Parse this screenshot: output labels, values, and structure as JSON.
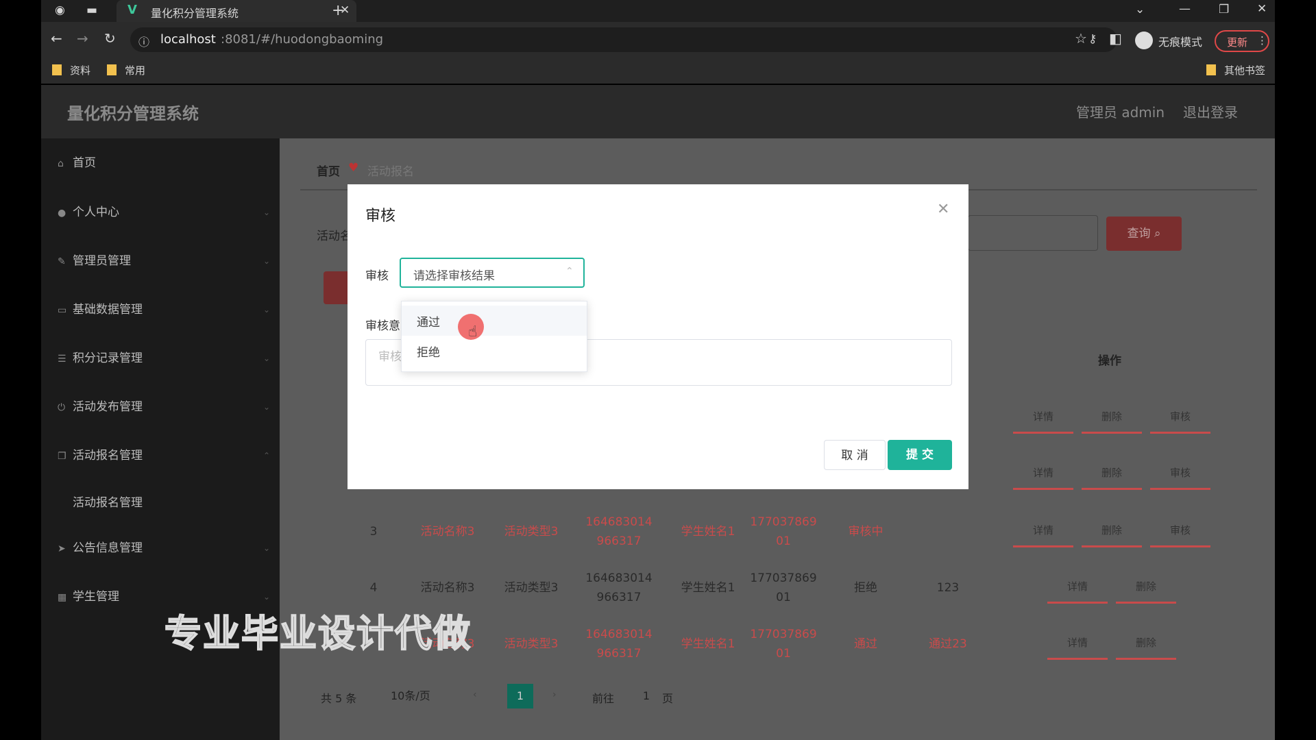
{
  "browser": {
    "tab_title": "量化积分管理系统",
    "url_host": "localhost",
    "url_rest": ":8081/#/huodongbaoming",
    "incognito_label": "无痕模式",
    "update_label": "更新",
    "bookmarks": [
      "资料",
      "常用"
    ],
    "other_bookmarks": "其他书签"
  },
  "header": {
    "app_title": "量化积分管理系统",
    "user_label": "管理员 admin",
    "logout_label": "退出登录"
  },
  "sidebar": {
    "items": [
      {
        "label": "首页"
      },
      {
        "label": "个人中心"
      },
      {
        "label": "管理员管理"
      },
      {
        "label": "基础数据管理"
      },
      {
        "label": "积分记录管理"
      },
      {
        "label": "活动发布管理"
      },
      {
        "label": "活动报名管理"
      },
      {
        "label": "活动报名管理"
      },
      {
        "label": "公告信息管理"
      },
      {
        "label": "学生管理"
      }
    ]
  },
  "breadcrumb": {
    "home": "首页",
    "current": "活动报名"
  },
  "search": {
    "label": "活动名",
    "button": "查询"
  },
  "table": {
    "op_header": "操作",
    "ops": {
      "detail": "详情",
      "delete": "删除",
      "review": "审核"
    },
    "rows": [
      {
        "index": "3",
        "name": "活动名称3",
        "type": "活动类型3",
        "id1": "164683014",
        "id2": "966317",
        "student": "学生姓名1",
        "phone1": "177037869",
        "phone2": "01",
        "status": "审核中",
        "remark": ""
      },
      {
        "index": "4",
        "name": "活动名称3",
        "type": "活动类型3",
        "id1": "164683014",
        "id2": "966317",
        "student": "学生姓名1",
        "phone1": "177037869",
        "phone2": "01",
        "status": "拒绝",
        "remark": "123"
      },
      {
        "index": "",
        "name": "活动名称3",
        "type": "活动类型3",
        "id1": "164683014",
        "id2": "966317",
        "student": "学生姓名1",
        "phone1": "177037869",
        "phone2": "01",
        "status": "通过",
        "remark": "通过23"
      }
    ]
  },
  "pagination": {
    "total": "共 5 条",
    "page_size": "10条/页",
    "current": "1",
    "goto_prefix": "前往",
    "goto_value": "1",
    "goto_suffix": "页"
  },
  "dialog": {
    "title": "审核",
    "review_label": "审核",
    "select_placeholder": "请选择审核结果",
    "opinion_label": "审核意",
    "opinion_placeholder": "审核",
    "options": [
      "通过",
      "拒绝"
    ],
    "cancel": "取 消",
    "submit": "提 交"
  },
  "watermark": "专业毕业设计代做",
  "colors": {
    "accent": "#1fb39a",
    "danger": "#c94b4b"
  }
}
